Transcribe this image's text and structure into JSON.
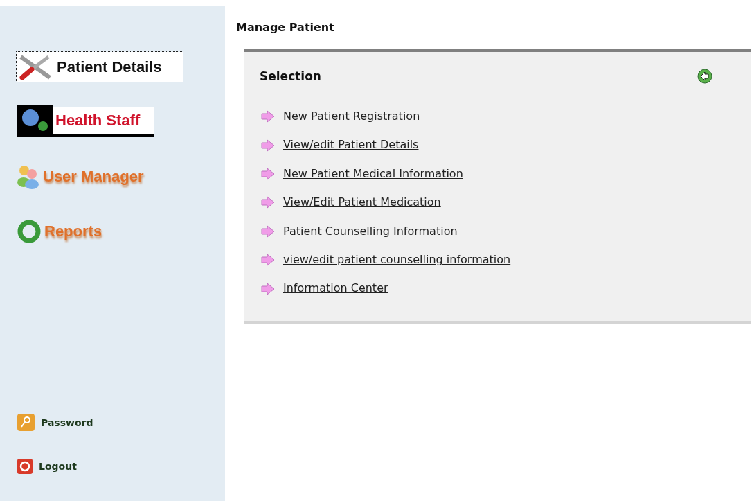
{
  "sidebar": {
    "nav": [
      {
        "label": "Patient Details",
        "kind": "tools",
        "selected": true
      },
      {
        "label": "Health Staff",
        "kind": "staff",
        "selected": false
      },
      {
        "label": "User Manager",
        "kind": "users",
        "selected": false
      },
      {
        "label": "Reports",
        "kind": "reports",
        "selected": false
      }
    ],
    "bottom": [
      {
        "label": "Password",
        "kind": "key"
      },
      {
        "label": "Logout",
        "kind": "power"
      }
    ]
  },
  "main": {
    "title": "Manage Patient",
    "panel": {
      "title": "Selection",
      "links": [
        "New Patient Registration",
        "View/edit Patient Details",
        "New Patient Medical Information",
        "View/Edit Patient Medication",
        "Patient Counselling Information",
        "view/edit patient counselling information",
        "Information Center"
      ]
    }
  }
}
